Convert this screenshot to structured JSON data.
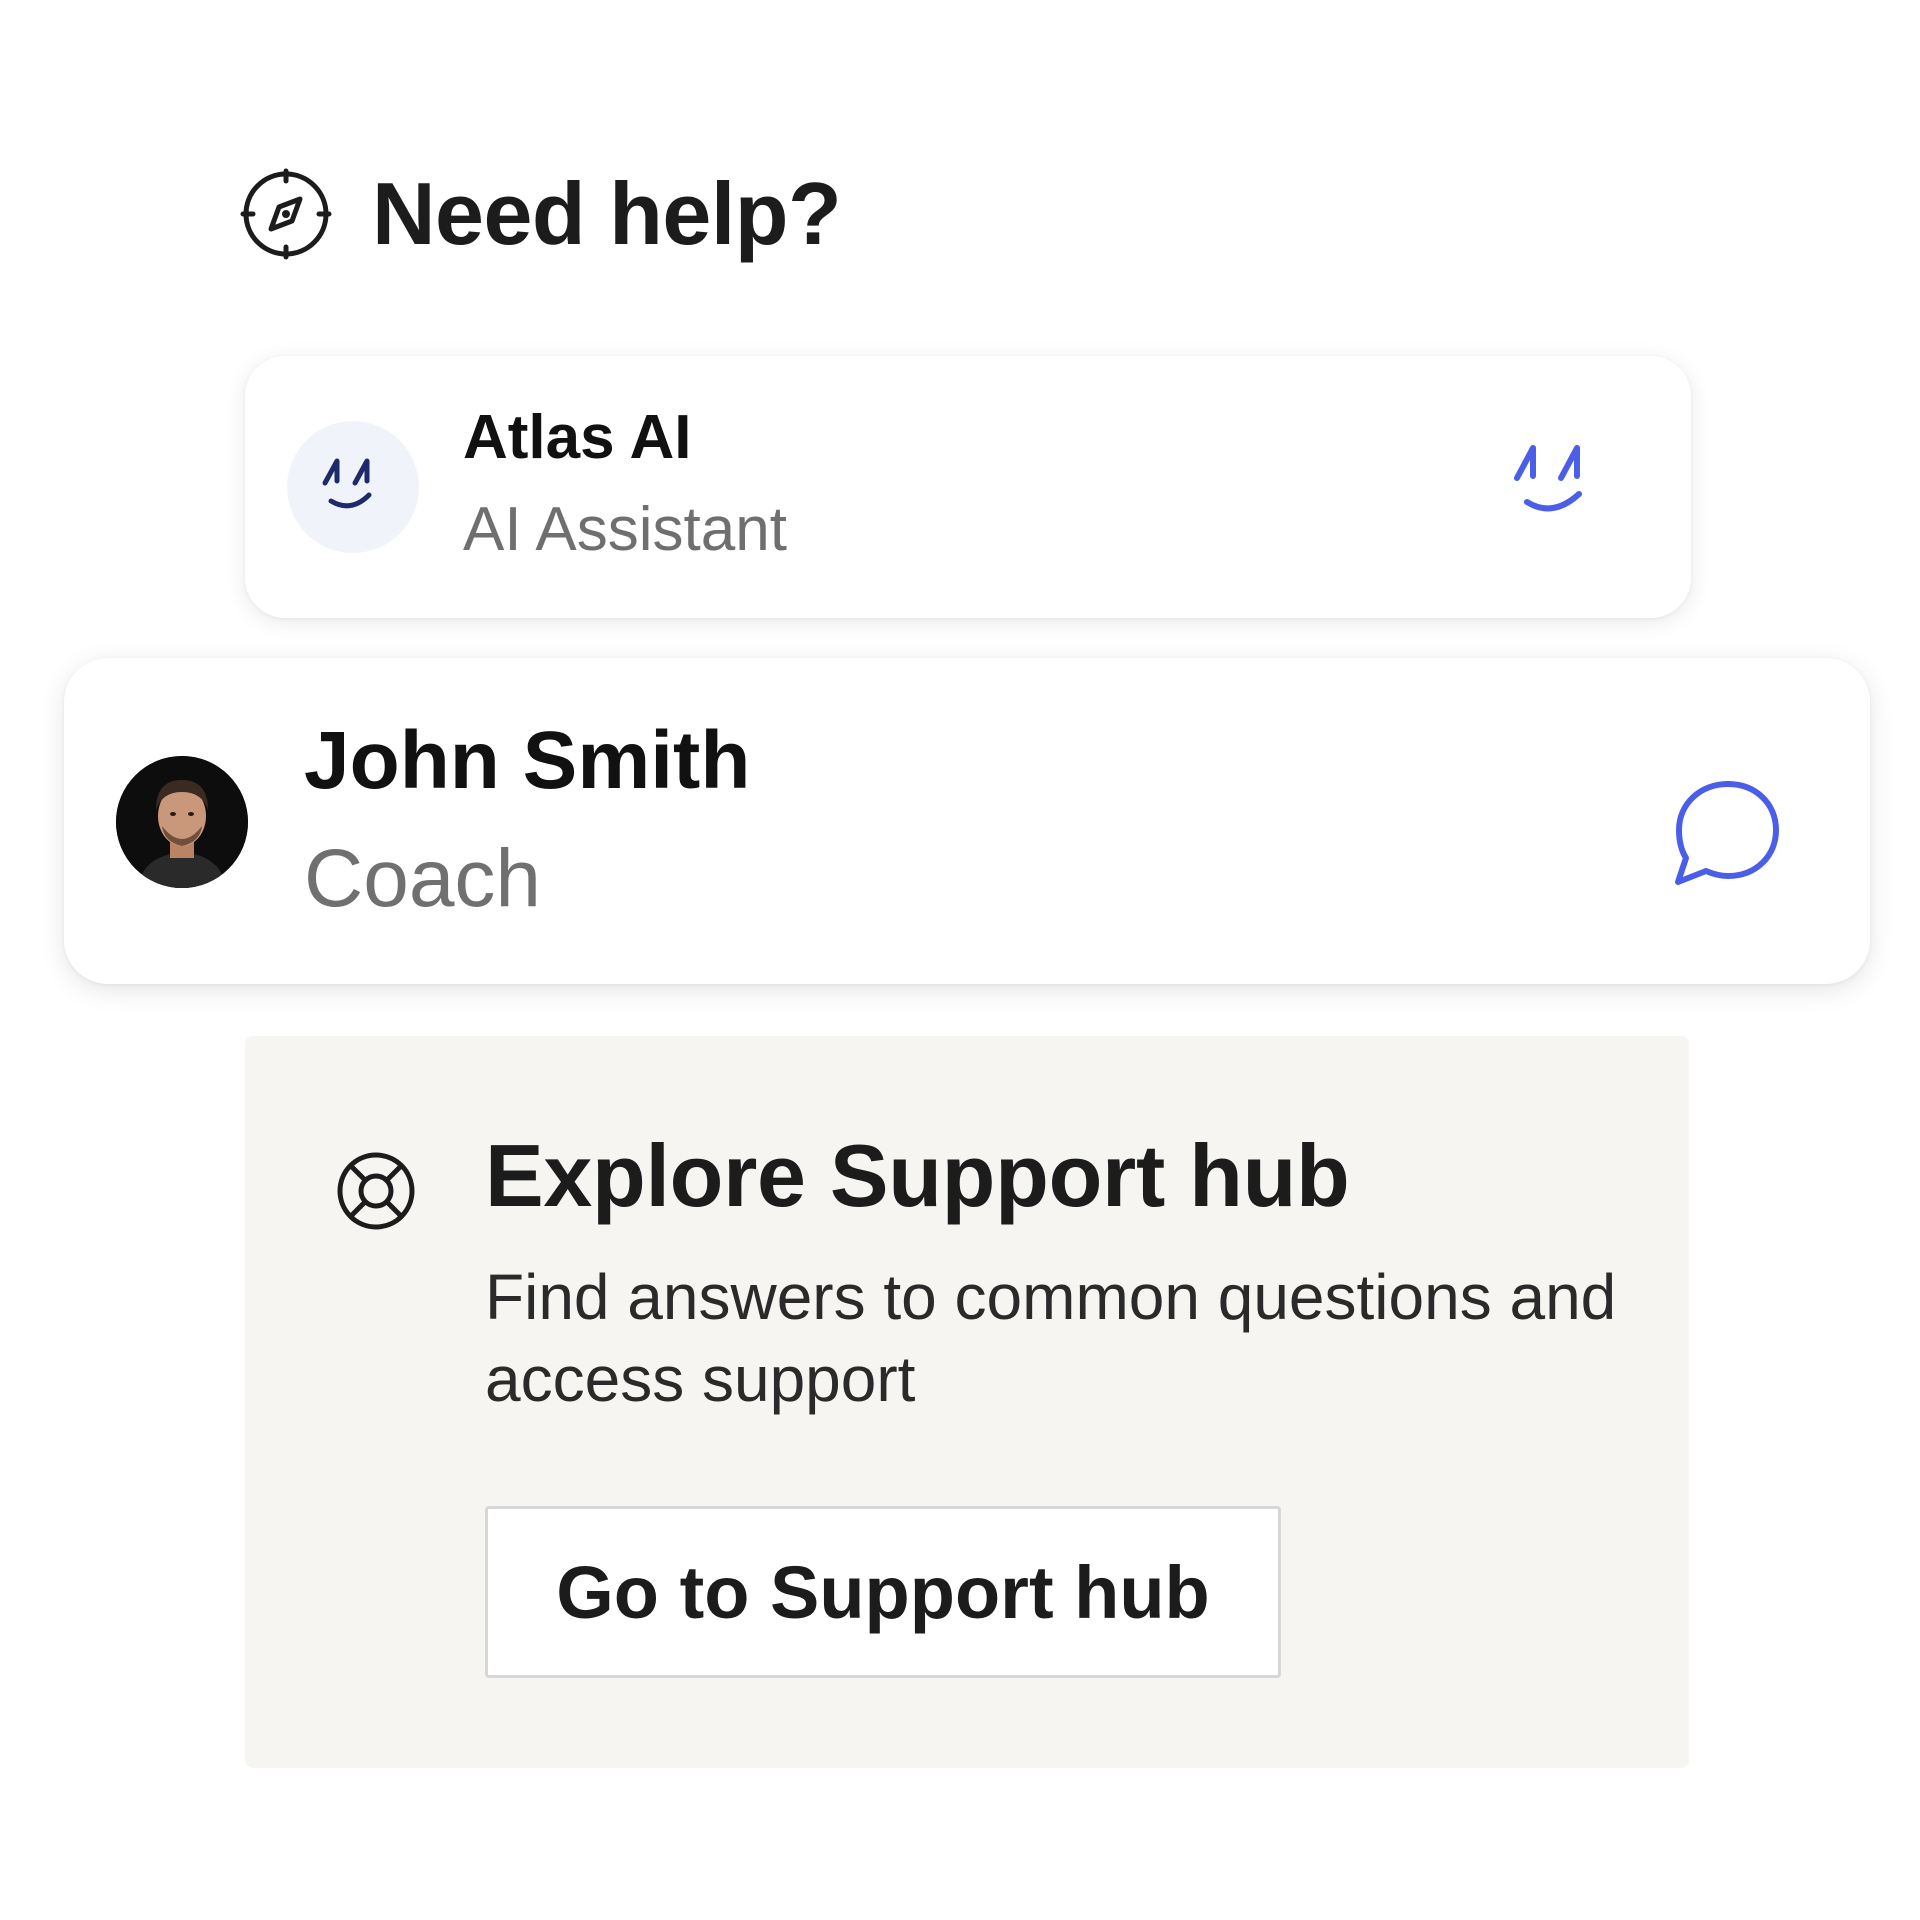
{
  "header": {
    "icon": "compass-icon",
    "title": "Need help?"
  },
  "contacts": [
    {
      "name": "Atlas AI",
      "role": "AI Assistant",
      "avatar": "atlas-ai-logo-icon",
      "action_icon": "atlas-ai-logo-icon"
    },
    {
      "name": "John Smith",
      "role": "Coach",
      "avatar": "profile-photo",
      "action_icon": "chat-bubble-icon"
    }
  ],
  "support": {
    "icon": "lifebuoy-icon",
    "heading": "Explore Support hub",
    "description": "Find answers to common questions and access support",
    "button_label": "Go to Support hub"
  },
  "colors": {
    "accent": "#4a5ee8",
    "text_primary": "#1c1c1c",
    "text_secondary": "#707070",
    "panel_bg": "#f6f5f2",
    "ai_avatar_bg": "#f1f3fb"
  }
}
